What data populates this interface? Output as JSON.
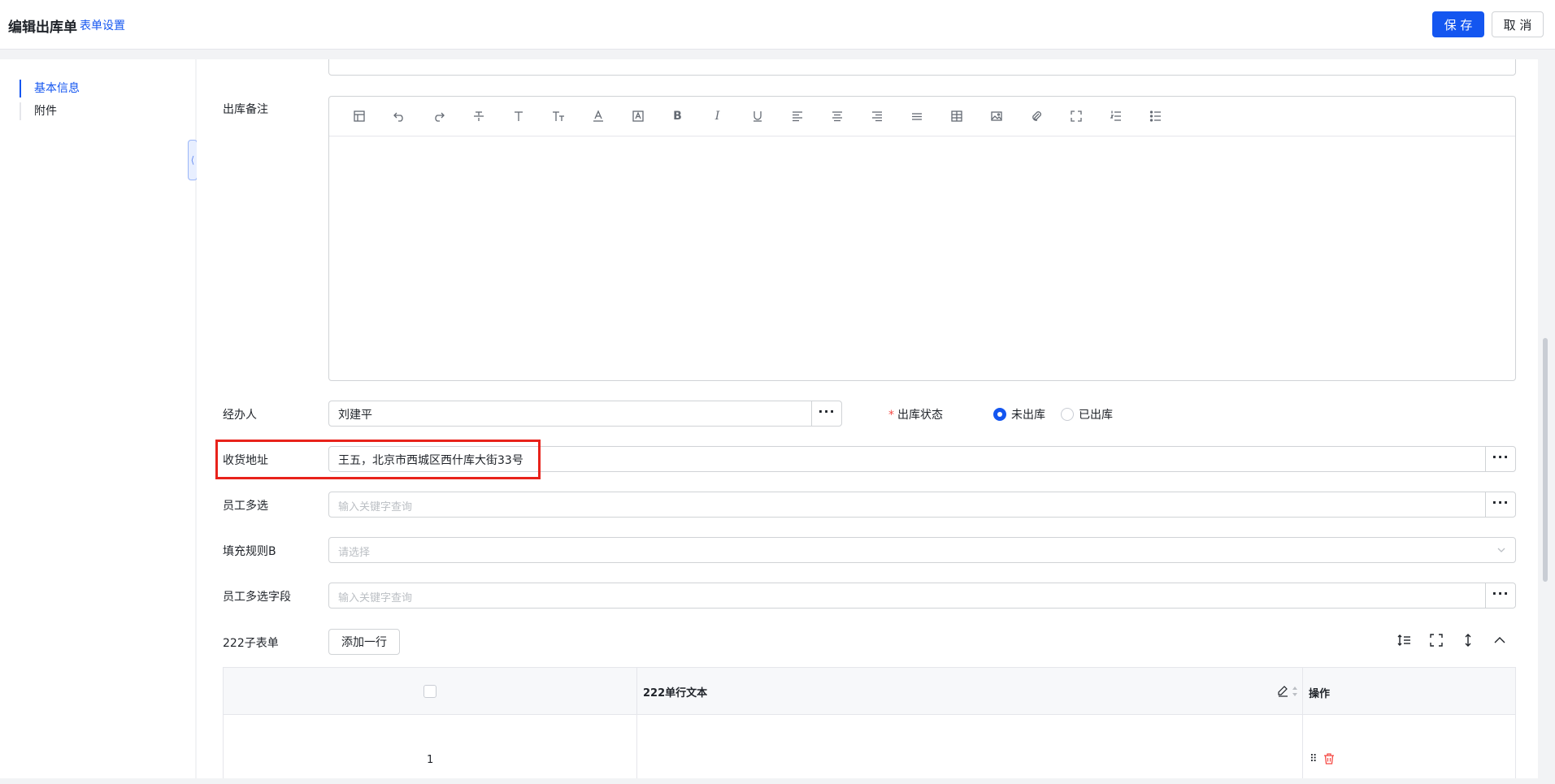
{
  "header": {
    "title": "编辑出库单",
    "settings_link": "表单设置",
    "save_label": "保 存",
    "cancel_label": "取 消"
  },
  "sidebar": {
    "items": [
      {
        "label": "基本信息",
        "active": true
      },
      {
        "label": "附件",
        "active": false
      }
    ]
  },
  "form": {
    "remark_label": "出库备注",
    "editor_tools": [
      "table-layout-icon",
      "undo-icon",
      "redo-icon",
      "strikethrough-icon",
      "text-icon",
      "font-size-icon",
      "font-color-icon",
      "background-color-icon",
      "bold-icon",
      "italic-icon",
      "underline-icon",
      "align-left-icon",
      "align-center-icon",
      "align-right-icon",
      "justify-icon",
      "insert-table-icon",
      "image-icon",
      "attachment-icon",
      "fullscreen-icon",
      "ordered-list-icon",
      "bullet-list-icon"
    ],
    "handler_label": "经办人",
    "handler_value": "刘建平",
    "status_label": "出库状态",
    "status_options": [
      "未出库",
      "已出库"
    ],
    "status_selected": "未出库",
    "address_label": "收货地址",
    "address_value": "王五，北京市西城区西什库大街33号",
    "staff_multi_label": "员工多选",
    "staff_multi_placeholder": "输入关键字查询",
    "fill_rule_label": "填充规则B",
    "fill_rule_placeholder": "请选择",
    "staff_field_label": "员工多选字段",
    "staff_field_placeholder": "输入关键字查询"
  },
  "subform": {
    "label": "222子表单",
    "add_row_label": "添加一行",
    "columns": [
      "222单行文本",
      "操作"
    ],
    "rows": [
      {
        "index": "1"
      }
    ]
  },
  "colors": {
    "accent": "#1456f0",
    "highlight": "#e8221b",
    "delete": "#f54a45"
  }
}
